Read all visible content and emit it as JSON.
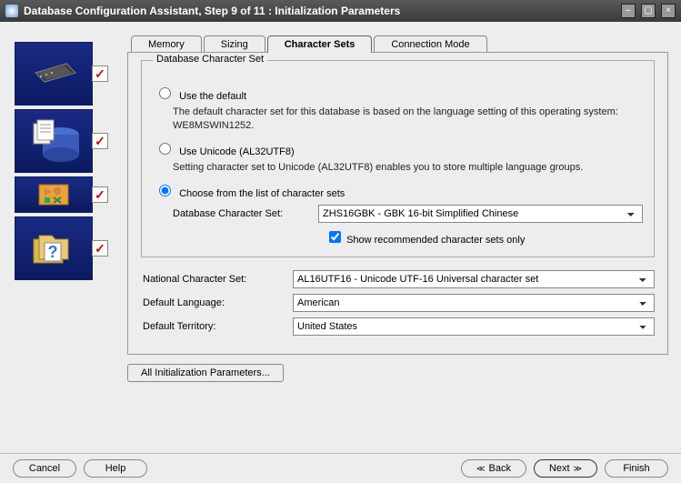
{
  "window": {
    "title": "Database Configuration Assistant, Step 9 of 11 : Initialization Parameters"
  },
  "tabs": {
    "memory": "Memory",
    "sizing": "Sizing",
    "charsets": "Character Sets",
    "connmode": "Connection Mode"
  },
  "fieldset_legend": "Database Character Set",
  "radios": {
    "default": {
      "label": "Use the default",
      "desc": "The default character set for this database is based on the language setting of this operating system: WE8MSWIN1252."
    },
    "unicode": {
      "label": "Use Unicode (AL32UTF8)",
      "desc": "Setting character set to Unicode (AL32UTF8) enables you to store multiple language groups."
    },
    "choose": {
      "label": "Choose from the list of character sets"
    }
  },
  "db_charset": {
    "label": "Database Character Set:",
    "value": "ZHS16GBK - GBK 16-bit Simplified Chinese"
  },
  "show_recommended": {
    "label": "Show recommended character sets only",
    "checked": true
  },
  "national_charset": {
    "label": "National Character Set:",
    "value": "AL16UTF16 - Unicode UTF-16 Universal character set"
  },
  "default_language": {
    "label": "Default Language:",
    "value": "American"
  },
  "default_territory": {
    "label": "Default Territory:",
    "value": "United States"
  },
  "buttons": {
    "all_params": "All Initialization Parameters...",
    "cancel": "Cancel",
    "help": "Help",
    "back": "Back",
    "next": "Next",
    "finish": "Finish"
  }
}
